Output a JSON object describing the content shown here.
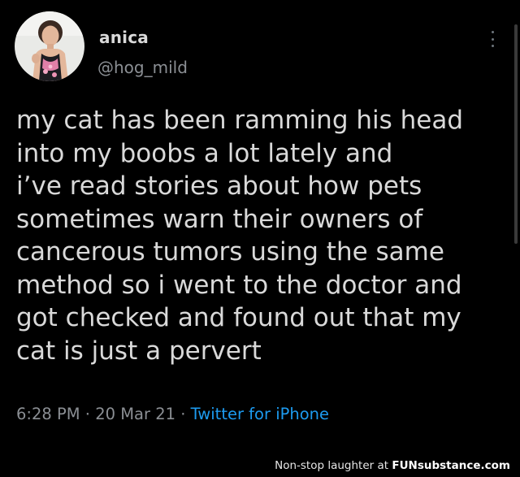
{
  "tweet": {
    "display_name": "anica",
    "handle": "@hog_mild",
    "text": "my cat has been ramming his head\ninto my boobs a lot lately and\ni’ve read stories about how pets\nsometimes warn their owners of\ncancerous tumors using the same\nmethod so i went to the doctor and\ngot checked and found out that my\ncat is just a pervert",
    "time": "6:28 PM",
    "separator1": " · ",
    "date": "20 Mar 21",
    "separator2": " · ",
    "source": "Twitter for iPhone",
    "more_icon": "more-vertical-icon",
    "avatar": "profile-photo"
  },
  "footer": {
    "caption": "Non-stop laughter at ",
    "brand": "FUNsubstance.com"
  },
  "colors": {
    "background": "#000000",
    "text": "#d9d9d9",
    "muted": "#8b8f94",
    "link": "#1d9bf0"
  }
}
